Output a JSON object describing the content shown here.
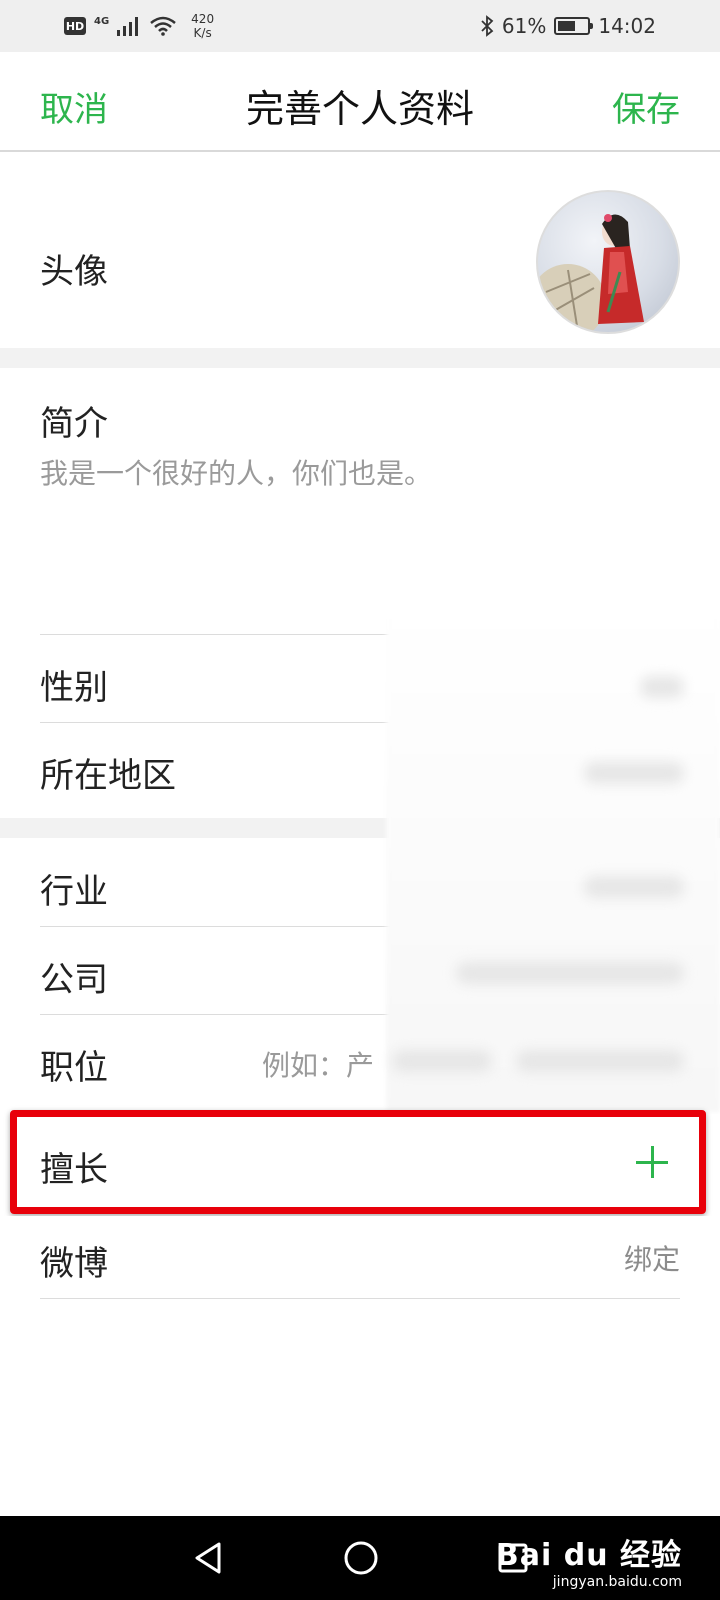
{
  "status_bar": {
    "hd": "HD",
    "network": "4G",
    "speed_value": "420",
    "speed_unit": "K/s",
    "bluetooth_icon": "bluetooth-icon",
    "battery_percent": "61%",
    "battery_level": 0.61,
    "time": "14:02"
  },
  "header": {
    "cancel_label": "取消",
    "title": "完善个人资料",
    "save_label": "保存"
  },
  "avatar": {
    "label": "头像"
  },
  "bio": {
    "label": "简介",
    "text": "我是一个很好的人，你们也是。"
  },
  "fields": {
    "gender": {
      "label": "性别"
    },
    "region": {
      "label": "所在地区"
    },
    "industry": {
      "label": "行业"
    },
    "company": {
      "label": "公司"
    },
    "position": {
      "label": "职位",
      "placeholder": "例如：产"
    },
    "expertise": {
      "label": "擅长",
      "action_icon": "plus-icon"
    },
    "weibo": {
      "label": "微博",
      "value": "绑定"
    }
  },
  "watermark": {
    "brand": "Bai du 经验",
    "url": "jingyan.baidu.com"
  },
  "colors": {
    "accent": "#2db54d",
    "highlight": "#e8000a",
    "status_bg": "#efefef",
    "section_gap": "#f2f2f2"
  }
}
